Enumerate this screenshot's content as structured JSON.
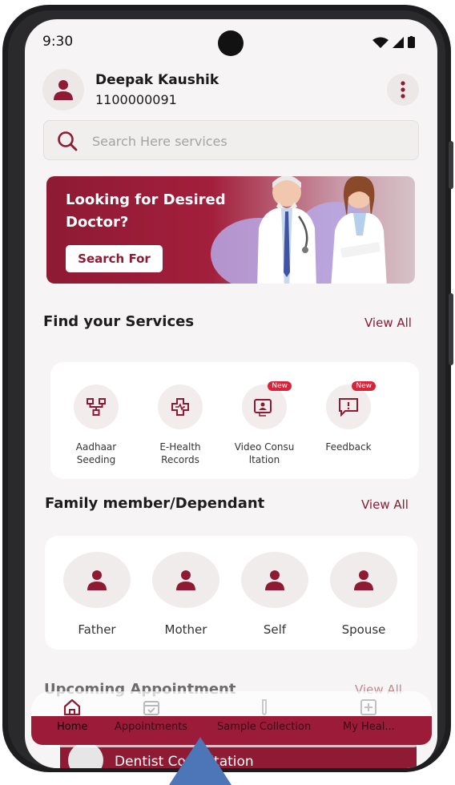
{
  "status_bar": {
    "time": "9:30"
  },
  "profile": {
    "name": "Deepak Kaushik",
    "id": "1100000091"
  },
  "search": {
    "placeholder": "Search Here services"
  },
  "banner": {
    "title": "Looking for Desired Doctor?",
    "button": "Search For"
  },
  "services": {
    "title": "Find your Services",
    "view_all": "View All",
    "items": [
      {
        "label": "Aadhaar Seeding",
        "icon": "network-icon",
        "badge": ""
      },
      {
        "label": "E-Health Records",
        "icon": "medical-cross-icon",
        "badge": ""
      },
      {
        "label": "Video Consu ltation",
        "icon": "video-call-icon",
        "badge": "New"
      },
      {
        "label": "Feedback",
        "icon": "feedback-icon",
        "badge": "New"
      }
    ]
  },
  "family": {
    "title": "Family member/Dependant",
    "view_all": "View All",
    "members": [
      {
        "label": "Father"
      },
      {
        "label": "Mother"
      },
      {
        "label": "Self"
      },
      {
        "label": "Spouse"
      }
    ]
  },
  "upcoming": {
    "title": "Upcoming Appointment",
    "view_all": "View All",
    "appointment": "Dentist Consultation"
  },
  "bottom_nav": {
    "items": [
      {
        "label": "Home",
        "icon": "home-icon"
      },
      {
        "label": "Appointments",
        "icon": "calendar-icon"
      },
      {
        "label": "Sample Collection",
        "icon": "test-tube-icon"
      },
      {
        "label": "My Heal...",
        "icon": "health-plus-icon"
      }
    ]
  },
  "colors": {
    "brand": "#8e1a33",
    "background": "#f6f4f4",
    "badge": "#d6243a"
  }
}
